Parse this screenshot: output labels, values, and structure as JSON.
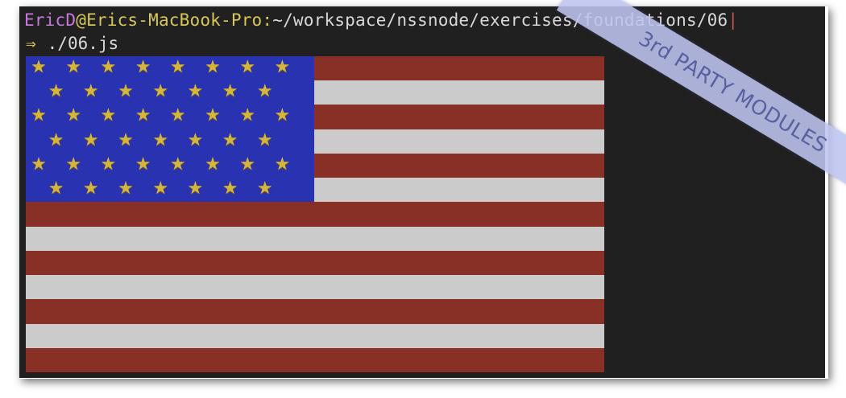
{
  "terminal": {
    "prompt": {
      "user": "EricD",
      "at": "@",
      "host": "Erics-MacBook-Pro",
      "colon": ":",
      "path": "~/workspace/nssnode/exercises/foundations/06",
      "cursor": "|"
    },
    "command": {
      "arrow": "⇒",
      "text": "./06.js"
    }
  },
  "flag": {
    "star_glyph": "★",
    "stripe_colors": {
      "red": "#9a3228",
      "white": "#e8e8e8"
    },
    "canton_color": "#2b36c8",
    "star_color": "#f2cf42",
    "stripe_count": 13,
    "star_rows": [
      8,
      7,
      8,
      7,
      8,
      7
    ]
  },
  "banner": {
    "label": "3rd PARTY MODULES"
  },
  "colors": {
    "terminal_bg": "#202020",
    "user": "#c678dd",
    "host": "#d7c65a",
    "path": "#d8d8d8"
  }
}
